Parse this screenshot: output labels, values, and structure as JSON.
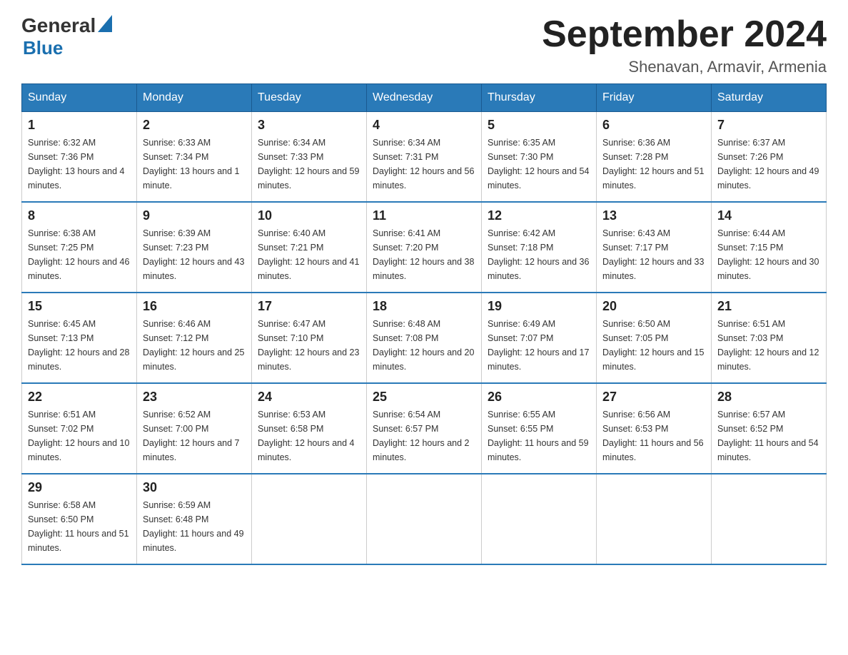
{
  "header": {
    "logo_general": "General",
    "logo_blue": "Blue",
    "title": "September 2024",
    "subtitle": "Shenavan, Armavir, Armenia"
  },
  "days_of_week": [
    "Sunday",
    "Monday",
    "Tuesday",
    "Wednesday",
    "Thursday",
    "Friday",
    "Saturday"
  ],
  "weeks": [
    [
      {
        "day": "1",
        "sunrise": "Sunrise: 6:32 AM",
        "sunset": "Sunset: 7:36 PM",
        "daylight": "Daylight: 13 hours and 4 minutes."
      },
      {
        "day": "2",
        "sunrise": "Sunrise: 6:33 AM",
        "sunset": "Sunset: 7:34 PM",
        "daylight": "Daylight: 13 hours and 1 minute."
      },
      {
        "day": "3",
        "sunrise": "Sunrise: 6:34 AM",
        "sunset": "Sunset: 7:33 PM",
        "daylight": "Daylight: 12 hours and 59 minutes."
      },
      {
        "day": "4",
        "sunrise": "Sunrise: 6:34 AM",
        "sunset": "Sunset: 7:31 PM",
        "daylight": "Daylight: 12 hours and 56 minutes."
      },
      {
        "day": "5",
        "sunrise": "Sunrise: 6:35 AM",
        "sunset": "Sunset: 7:30 PM",
        "daylight": "Daylight: 12 hours and 54 minutes."
      },
      {
        "day": "6",
        "sunrise": "Sunrise: 6:36 AM",
        "sunset": "Sunset: 7:28 PM",
        "daylight": "Daylight: 12 hours and 51 minutes."
      },
      {
        "day": "7",
        "sunrise": "Sunrise: 6:37 AM",
        "sunset": "Sunset: 7:26 PM",
        "daylight": "Daylight: 12 hours and 49 minutes."
      }
    ],
    [
      {
        "day": "8",
        "sunrise": "Sunrise: 6:38 AM",
        "sunset": "Sunset: 7:25 PM",
        "daylight": "Daylight: 12 hours and 46 minutes."
      },
      {
        "day": "9",
        "sunrise": "Sunrise: 6:39 AM",
        "sunset": "Sunset: 7:23 PM",
        "daylight": "Daylight: 12 hours and 43 minutes."
      },
      {
        "day": "10",
        "sunrise": "Sunrise: 6:40 AM",
        "sunset": "Sunset: 7:21 PM",
        "daylight": "Daylight: 12 hours and 41 minutes."
      },
      {
        "day": "11",
        "sunrise": "Sunrise: 6:41 AM",
        "sunset": "Sunset: 7:20 PM",
        "daylight": "Daylight: 12 hours and 38 minutes."
      },
      {
        "day": "12",
        "sunrise": "Sunrise: 6:42 AM",
        "sunset": "Sunset: 7:18 PM",
        "daylight": "Daylight: 12 hours and 36 minutes."
      },
      {
        "day": "13",
        "sunrise": "Sunrise: 6:43 AM",
        "sunset": "Sunset: 7:17 PM",
        "daylight": "Daylight: 12 hours and 33 minutes."
      },
      {
        "day": "14",
        "sunrise": "Sunrise: 6:44 AM",
        "sunset": "Sunset: 7:15 PM",
        "daylight": "Daylight: 12 hours and 30 minutes."
      }
    ],
    [
      {
        "day": "15",
        "sunrise": "Sunrise: 6:45 AM",
        "sunset": "Sunset: 7:13 PM",
        "daylight": "Daylight: 12 hours and 28 minutes."
      },
      {
        "day": "16",
        "sunrise": "Sunrise: 6:46 AM",
        "sunset": "Sunset: 7:12 PM",
        "daylight": "Daylight: 12 hours and 25 minutes."
      },
      {
        "day": "17",
        "sunrise": "Sunrise: 6:47 AM",
        "sunset": "Sunset: 7:10 PM",
        "daylight": "Daylight: 12 hours and 23 minutes."
      },
      {
        "day": "18",
        "sunrise": "Sunrise: 6:48 AM",
        "sunset": "Sunset: 7:08 PM",
        "daylight": "Daylight: 12 hours and 20 minutes."
      },
      {
        "day": "19",
        "sunrise": "Sunrise: 6:49 AM",
        "sunset": "Sunset: 7:07 PM",
        "daylight": "Daylight: 12 hours and 17 minutes."
      },
      {
        "day": "20",
        "sunrise": "Sunrise: 6:50 AM",
        "sunset": "Sunset: 7:05 PM",
        "daylight": "Daylight: 12 hours and 15 minutes."
      },
      {
        "day": "21",
        "sunrise": "Sunrise: 6:51 AM",
        "sunset": "Sunset: 7:03 PM",
        "daylight": "Daylight: 12 hours and 12 minutes."
      }
    ],
    [
      {
        "day": "22",
        "sunrise": "Sunrise: 6:51 AM",
        "sunset": "Sunset: 7:02 PM",
        "daylight": "Daylight: 12 hours and 10 minutes."
      },
      {
        "day": "23",
        "sunrise": "Sunrise: 6:52 AM",
        "sunset": "Sunset: 7:00 PM",
        "daylight": "Daylight: 12 hours and 7 minutes."
      },
      {
        "day": "24",
        "sunrise": "Sunrise: 6:53 AM",
        "sunset": "Sunset: 6:58 PM",
        "daylight": "Daylight: 12 hours and 4 minutes."
      },
      {
        "day": "25",
        "sunrise": "Sunrise: 6:54 AM",
        "sunset": "Sunset: 6:57 PM",
        "daylight": "Daylight: 12 hours and 2 minutes."
      },
      {
        "day": "26",
        "sunrise": "Sunrise: 6:55 AM",
        "sunset": "Sunset: 6:55 PM",
        "daylight": "Daylight: 11 hours and 59 minutes."
      },
      {
        "day": "27",
        "sunrise": "Sunrise: 6:56 AM",
        "sunset": "Sunset: 6:53 PM",
        "daylight": "Daylight: 11 hours and 56 minutes."
      },
      {
        "day": "28",
        "sunrise": "Sunrise: 6:57 AM",
        "sunset": "Sunset: 6:52 PM",
        "daylight": "Daylight: 11 hours and 54 minutes."
      }
    ],
    [
      {
        "day": "29",
        "sunrise": "Sunrise: 6:58 AM",
        "sunset": "Sunset: 6:50 PM",
        "daylight": "Daylight: 11 hours and 51 minutes."
      },
      {
        "day": "30",
        "sunrise": "Sunrise: 6:59 AM",
        "sunset": "Sunset: 6:48 PM",
        "daylight": "Daylight: 11 hours and 49 minutes."
      },
      {
        "day": "",
        "sunrise": "",
        "sunset": "",
        "daylight": ""
      },
      {
        "day": "",
        "sunrise": "",
        "sunset": "",
        "daylight": ""
      },
      {
        "day": "",
        "sunrise": "",
        "sunset": "",
        "daylight": ""
      },
      {
        "day": "",
        "sunrise": "",
        "sunset": "",
        "daylight": ""
      },
      {
        "day": "",
        "sunrise": "",
        "sunset": "",
        "daylight": ""
      }
    ]
  ]
}
